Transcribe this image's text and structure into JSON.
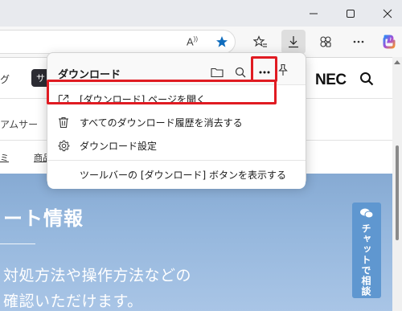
{
  "window": {
    "minimize_icon": "minimize-icon",
    "maximize_icon": "maximize-icon",
    "close_icon": "close-icon"
  },
  "toolbar": {
    "read_aloud_glyph": "A",
    "read_aloud_sup": "))",
    "icons": [
      "read-aloud-icon",
      "favorite-star-icon",
      "favorites-list-icon",
      "download-icon",
      "extensions-icon",
      "more-icon",
      "copilot-icon"
    ],
    "accent_color": "#0f6cbd"
  },
  "page": {
    "nav_left_text": "グ",
    "nav_pill_text": "サ",
    "logo_text": "NEC",
    "sub_nav_text": "アムサー",
    "link_1": "ミ",
    "link_2": "商品",
    "hero": {
      "title": "ート情報",
      "line_1": "対処方法や操作方法などの",
      "line_2": "確認いただけます。"
    },
    "chat_button_label": "チャットで相談"
  },
  "downloads_panel": {
    "title": "ダウンロード",
    "header_icons": [
      "folder-icon",
      "search-icon",
      "more-options-icon",
      "pin-icon"
    ],
    "menu": {
      "open_page": "[ダウンロード] ページを開く",
      "clear_history": "すべてのダウンロード履歴を消去する",
      "settings": "ダウンロード設定",
      "show_in_toolbar": "ツールバーの [ダウンロード] ボタンを表示する"
    },
    "highlight_color": "#e01b22"
  }
}
